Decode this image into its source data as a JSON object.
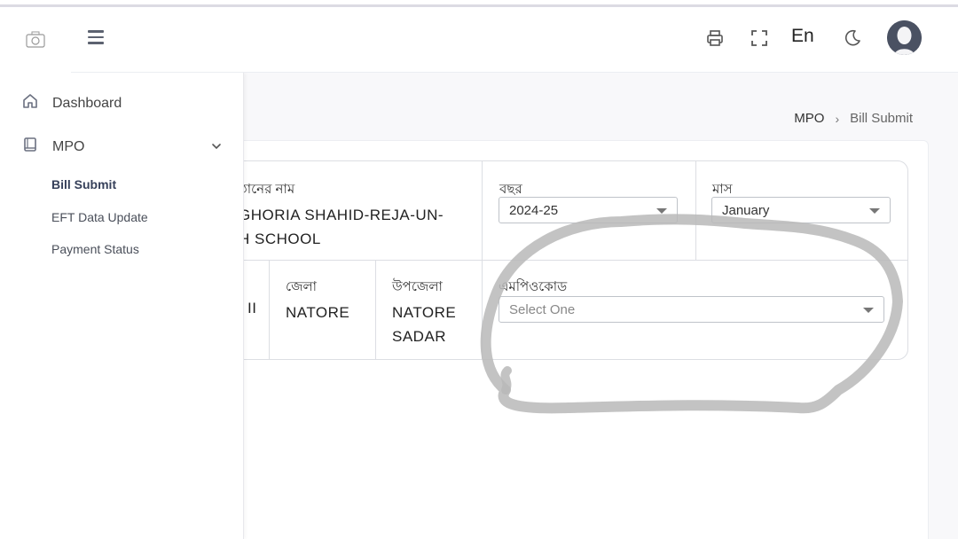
{
  "header": {
    "language": "En",
    "icons": [
      "print-icon",
      "fullscreen-icon",
      "moon-icon",
      "user-avatar"
    ]
  },
  "breadcrumb": {
    "parent": "MPO",
    "separator": "›",
    "current": "Bill Submit"
  },
  "sidebar": {
    "items": [
      {
        "label": "Dashboard",
        "icon": "home-icon"
      },
      {
        "label": "MPO",
        "icon": "book-icon"
      }
    ],
    "submenu": [
      {
        "label": "Bill Submit",
        "active": true
      },
      {
        "label": "EFT Data Update"
      },
      {
        "label": "Payment Status"
      }
    ]
  },
  "form": {
    "institution_label": "ষ্ঠানের নাম",
    "institution_line1": "GHORIA SHAHID-REJA-UN-",
    "institution_line2": "H SCHOOL",
    "year_label": "বছর",
    "year_value": "2024-25",
    "month_label": "মাস",
    "month_value": "January",
    "division_value": "II",
    "district_label": "জেলা",
    "district_value": "NATORE",
    "upazila_label": "উপজেলা",
    "upazila_line1": "NATORE",
    "upazila_line2": "SADAR",
    "mpo_code_label": "এমপিওকোড",
    "mpo_code_placeholder": "Select One"
  },
  "colors": {
    "sidebar_text": "#444444",
    "active_submenu": "#36405a",
    "border": "#dcdee3",
    "scribble": "#b5b5b5"
  }
}
